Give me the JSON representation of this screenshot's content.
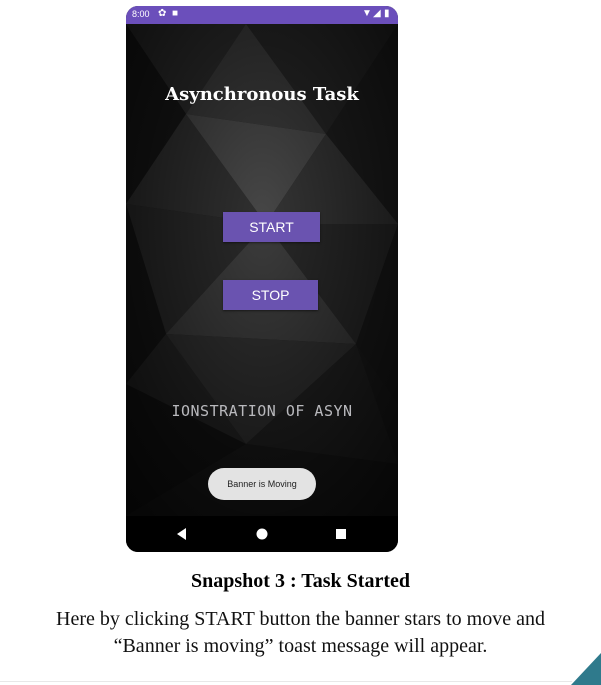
{
  "status_bar": {
    "time": "8:00",
    "left_icons": [
      "gear-icon",
      "sd-card-icon"
    ],
    "right_icons": [
      "wifi-icon",
      "signal-icon",
      "battery-icon"
    ],
    "color": "#6b4fbb"
  },
  "app": {
    "title": "Asynchronous Task",
    "start_label": "START",
    "stop_label": "STOP",
    "banner_text": "IONSTRATION OF ASYN",
    "toast_text": "Banner is Moving",
    "accent": "#6a53b0"
  },
  "nav_bar": {
    "icons": [
      "back-icon",
      "home-icon",
      "recents-icon"
    ]
  },
  "caption": {
    "title": "Snapshot 3 : Task Started",
    "line1": "Here by clicking START button the banner stars to move and",
    "line2": "“Banner is moving” toast message will appear."
  }
}
